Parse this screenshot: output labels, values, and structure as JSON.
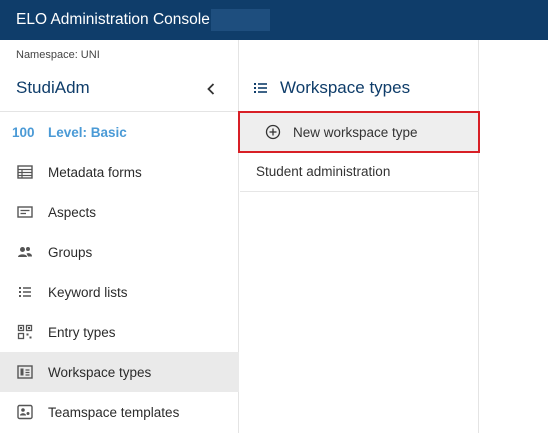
{
  "header": {
    "title": "ELO Administration Console"
  },
  "sidebar": {
    "namespace": "Namespace: UNI",
    "app_name": "StudiAdm",
    "level_number": "100",
    "level_label": "Level: Basic",
    "items": [
      {
        "label": "Metadata forms",
        "icon": "form-icon"
      },
      {
        "label": "Aspects",
        "icon": "aspect-icon"
      },
      {
        "label": "Groups",
        "icon": "groups-icon"
      },
      {
        "label": "Keyword lists",
        "icon": "list-icon"
      },
      {
        "label": "Entry types",
        "icon": "entry-types-icon"
      },
      {
        "label": "Workspace types",
        "icon": "workspace-icon"
      },
      {
        "label": "Teamspace templates",
        "icon": "teamspace-icon"
      }
    ]
  },
  "panel": {
    "title": "Workspace types",
    "new_label": "New workspace type",
    "items": [
      "Student administration"
    ]
  },
  "colors": {
    "header_bg": "#0f3d6a",
    "accent": "#4a9ad6",
    "highlight": "#d81f26"
  }
}
